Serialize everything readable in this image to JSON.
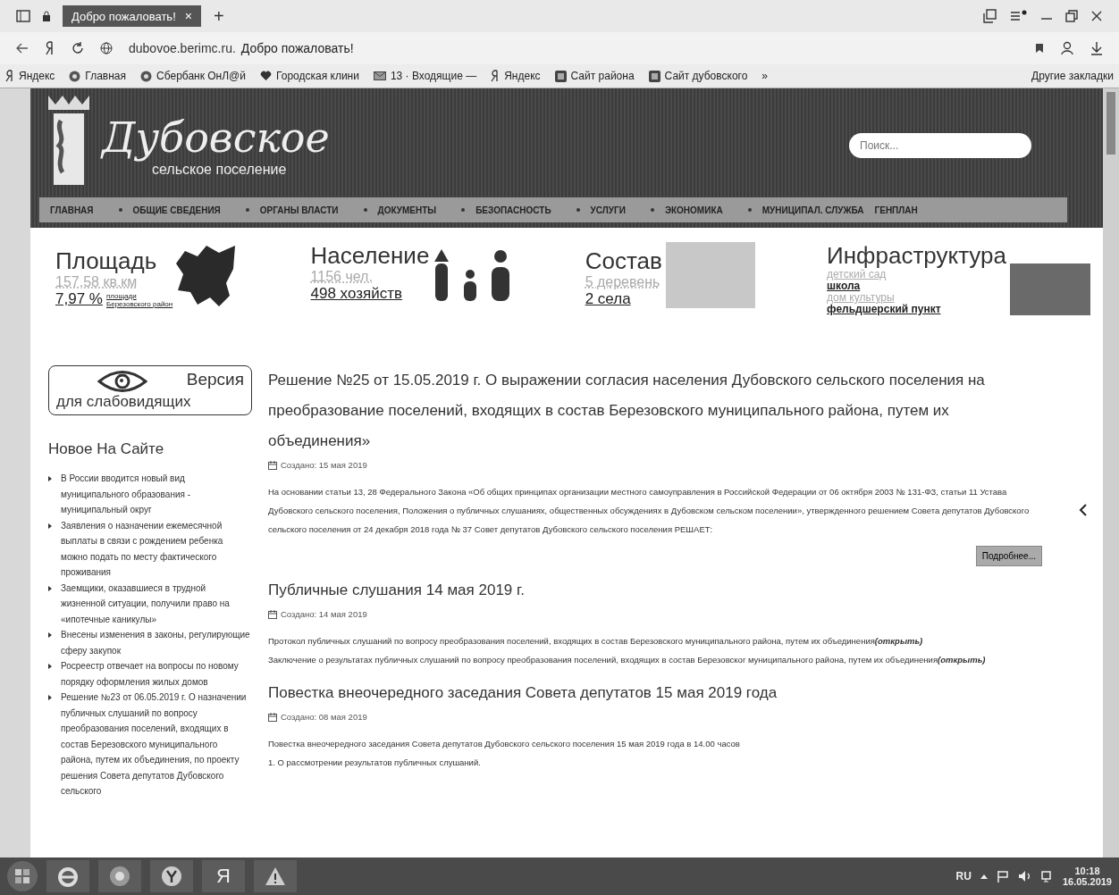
{
  "browser": {
    "tab": {
      "title": "Добро пожаловать!",
      "close": "×",
      "selected": true
    },
    "new_tab": "+",
    "address": {
      "domain": "dubovoe.berimc.ru.",
      "title": "Добро пожаловать!"
    },
    "bookmarks": [
      {
        "label": "Яндекс",
        "kind": "ya"
      },
      {
        "label": "Главная",
        "kind": "globe"
      },
      {
        "label": "Сбербанк ОнЛ@й",
        "kind": "globe"
      },
      {
        "label": "Городская клини",
        "kind": "heart"
      },
      {
        "label": "13 · Входящие —",
        "kind": "mail"
      },
      {
        "label": "Яндекс",
        "kind": "ya"
      },
      {
        "label": "Сайт района",
        "kind": "site"
      },
      {
        "label": "Сайт дубовского",
        "kind": "site"
      }
    ],
    "more": "»",
    "other_bookmarks": "Другие закладки"
  },
  "header": {
    "logo_title": "Дубовское",
    "logo_subtitle": "сельское поселение",
    "search": {
      "placeholder": "Поиск..."
    },
    "nav": [
      "ГЛАВНАЯ",
      "ОБЩИЕ СВЕДЕНИЯ",
      "ОРГАНЫ ВЛАСТИ",
      "ДОКУМЕНТЫ",
      "БЕЗОПАСНОСТЬ",
      "УСЛУГИ",
      "ЭКОНОМИКА",
      "МУНИЦИПАЛ. СЛУЖБА",
      "ГЕНПЛАН"
    ]
  },
  "stats": [
    {
      "kind": "area",
      "title": "Площадь",
      "line1": "157,58 кв.км",
      "value": "7,97 %",
      "note1": "площади",
      "note2": "Березовского район"
    },
    {
      "kind": "population",
      "title": "Население",
      "line1": "1156 чел.",
      "value": "498 хозяйств"
    },
    {
      "kind": "villages",
      "title": "Состав",
      "line1": "5 деревень",
      "value": "2 села"
    },
    {
      "kind": "infra",
      "title": "Инфраструктура",
      "items": [
        {
          "label": "детский сад",
          "faded": true
        },
        {
          "label": "школа",
          "faded": false
        },
        {
          "label": "дом культуры",
          "faded": true
        },
        {
          "label": "фельдшерский пункт",
          "faded": false
        }
      ]
    }
  ],
  "sidebar": {
    "accessibility": {
      "line1": "Версия",
      "line2": "для слабовидящих"
    },
    "news_title": "Новое На Сайте",
    "news": [
      "В России вводится новый вид муниципального образования - муниципальный округ",
      "Заявления о назначении ежемесячной выплаты в связи с рождением ребенка можно подать по месту фактического проживания",
      "Заемщики, оказавшиеся в трудной жизненной ситуации, получили право на «ипотечные каникулы»",
      "Внесены изменения в законы, регулирующие сферу закупок",
      "Росреестр отвечает на вопросы по новому порядку оформления жилых домов",
      "Решение №23 от 06.05.2019 г. О назначении публичных слушаний по вопросу преобразования поселений, входящих в состав Березовского муниципального района, путем их объединения, по проекту решения Совета депутатов Дубовского сельского"
    ]
  },
  "articles": [
    {
      "title": "Решение №25 от 15.05.2019 г. О выражении согласия населения Дубовского сельского поселения на преобразование поселений, входящих в состав Березовского муниципального района, путем их объединения»",
      "created": "Создано: 15 мая 2019",
      "paragraphs": [
        {
          "text": "На основании статьи 13, 28 Федерального Закона «Об общих принципах организации местного самоуправления в Российской Федерации от 06 октября 2003 № 131-ФЗ, статьи 11 Устава Дубовского сельского поселения, Положения о публичных слушаниях, общественных обсуждениях в Дубовском сельском поселении», утвержденного решением Совета депутатов Дубовского сельского поселения от 24 декабря 2018 года № 37 Совет депутатов Дубовского сельского поселения РЕШАЕТ:"
        }
      ],
      "more": "Подробнее..."
    },
    {
      "title": "Публичные слушания 14 мая 2019 г.",
      "created": "Создано: 14 мая 2019",
      "paragraphs": [
        {
          "text": "Протокол публичных слушаний по вопросу преобразования поселений, входящих в состав Березовского муниципального района, путем их объединения",
          "link": "(открыть)"
        },
        {
          "text": "Заключение о результатах публичных слушаний по вопросу преобразования поселений, входящих в состав Березовског муниципального района, путем их объединения",
          "link": "(открыть)"
        }
      ]
    },
    {
      "title": "Повестка внеочередного заседания Совета депутатов 15 мая 2019 года",
      "created": "Создано: 08 мая 2019",
      "paragraphs": [
        {
          "text": "Повестка внеочередного заседания Совета депутатов Дубовского сельского поселения 15 мая 2019 года в 14.00 часов"
        },
        {
          "text": "1. О рассмотрении результатов публичных слушаний."
        }
      ]
    }
  ],
  "taskbar": {
    "apps": [
      {
        "kind": "ie"
      },
      {
        "kind": "chrome"
      },
      {
        "kind": "yandex-browser"
      },
      {
        "kind": "ya",
        "label": "Я"
      },
      {
        "kind": "warning"
      }
    ],
    "language": "RU",
    "time": "10:18",
    "date": "16.05.2019"
  }
}
